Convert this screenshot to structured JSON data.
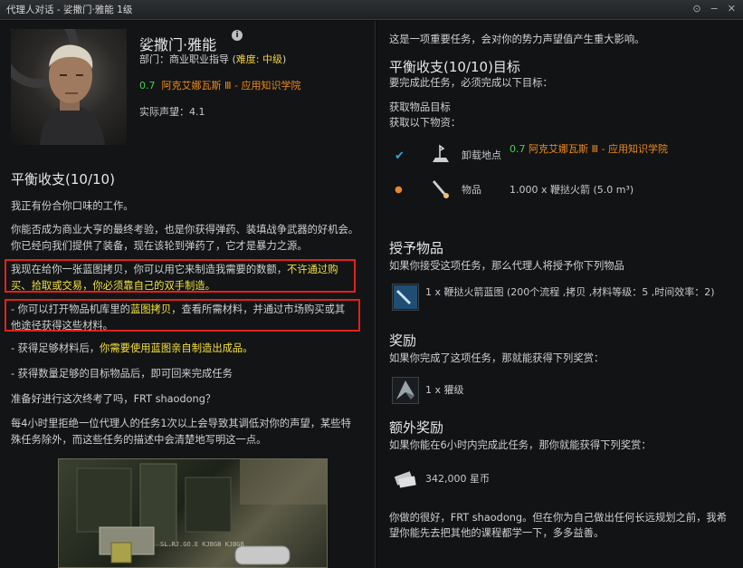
{
  "window": {
    "title": "代理人对话 - 娑撒门·雅能 1级",
    "controls": [
      "⊙",
      "−",
      "✕"
    ]
  },
  "agent": {
    "name": "娑撒门·雅能",
    "dept_prefix": "部门：商业职业指导 (",
    "difficulty": "难度: 中级",
    "dept_suffix": ")",
    "sec": "0.7",
    "location": "阿克艾娜瓦斯 Ⅲ - 应用知识学院",
    "standing": "实际声望：4.1"
  },
  "mission": {
    "title": "平衡收支(10/10)",
    "p1": "我正有份合你口味的工作。",
    "p2": "你能否成为商业大亨的最终考验，也是你获得弹药、装填战争武器的好机会。你已经向我们提供了装备，现在该轮到弹药了，它才是暴力之源。",
    "p3_a": "我现在给你一张蓝图拷贝，你可以用它来制造我需要的数额，",
    "p3_b": "不许通过购买、拾取或交易，你必须靠自己的双手制造。",
    "p4_a": "- 你可以打开物品机库里的",
    "p4_b": "蓝图拷贝",
    "p4_c": "，查看所需材料，并通过市场购买或其他途径获得这些材料。",
    "p5_a": "- 获得足够材料后，",
    "p5_b": "你需要使用蓝图亲自制造出成品。",
    "p6": "- 获得数量足够的目标物品后，即可回来完成任务",
    "p7": "准备好进行这次终考了吗，FRT shaodong？",
    "p8": "每4小时里拒绝一位代理人的任务1次以上会导致其调低对你的声望，某些特殊任务除外，而这些任务的描述中会清楚地写明这一点。",
    "art_caption": "SL.RJ.GO.E KJBGB KJBGB"
  },
  "objectives": {
    "intro": "这是一项重要任务，会对你的势力声望值产生重大影响。",
    "title": "平衡收支(10/10)目标",
    "sub": "要完成此任务，必须完成以下目标：",
    "acquire_title": "获取物品目标",
    "acquire_sub": "获取以下物资：",
    "rows": [
      {
        "mark": "✔",
        "label": "卸载地点",
        "sec": "0.7",
        "value": "阿克艾娜瓦斯 Ⅲ - 应用知识学院"
      },
      {
        "mark": "●",
        "label": "物品",
        "value": "1.000 x 鞭挞火箭 (5.0 m³)"
      }
    ]
  },
  "granted": {
    "title": "授予物品",
    "sub": "如果你接受这项任务，那么代理人将授予你下列物品",
    "item": "1 x 鞭挞火箭蓝图 (200个流程 ,拷贝 ,材料等级：5 ,时间效率：2)"
  },
  "reward": {
    "title": "奖励",
    "sub": "如果你完成了这项任务，那就能获得下列奖赏：",
    "item": "1 x 獾级"
  },
  "bonus": {
    "title": "额外奖励",
    "sub": "如果你能在6小时内完成此任务，那你就能获得下列奖赏：",
    "item": "342,000 星币"
  },
  "closing": "你做的很好，FRT shaodong。但在你为自己做出任何长远规划之前，我希望你能先去把其他的课程都学一下，多多益善。",
  "colors": {
    "accent_yellow": "#f4e23c",
    "sec_green": "#47d046",
    "location_orange": "#f08a1c",
    "highlight_red": "#e3211b"
  }
}
